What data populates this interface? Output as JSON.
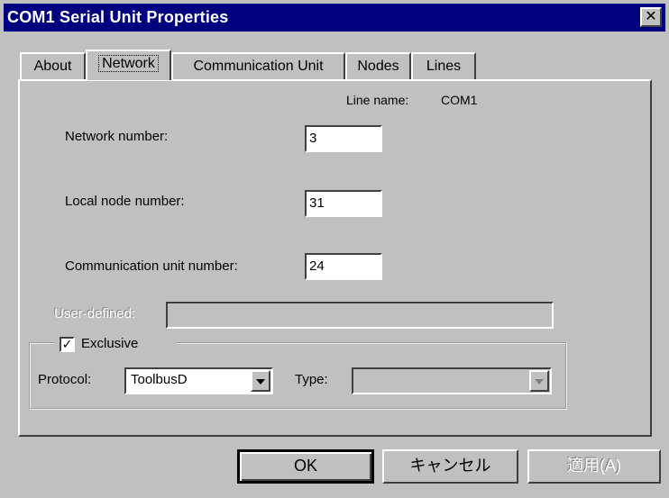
{
  "window": {
    "title": "COM1 Serial Unit Properties",
    "close_glyph": "✕"
  },
  "tabs": [
    {
      "label": "About"
    },
    {
      "label": "Network"
    },
    {
      "label": "Communication Unit"
    },
    {
      "label": "Nodes"
    },
    {
      "label": "Lines"
    }
  ],
  "network": {
    "line_name_label": "Line name:",
    "line_name_value": "COM1",
    "network_number_label": "Network number:",
    "network_number_value": "3",
    "local_node_label": "Local node number:",
    "local_node_value": "31",
    "comm_unit_label": "Communication unit number:",
    "comm_unit_value": "24",
    "user_defined_label": "User-defined:",
    "user_defined_value": "",
    "exclusive_label": "Exclusive",
    "exclusive_checked": "✓",
    "protocol_label": "Protocol:",
    "protocol_value": "ToolbusD",
    "type_label": "Type:",
    "type_value": ""
  },
  "buttons": {
    "ok": "OK",
    "cancel": "キャンセル",
    "apply": "適用(A)"
  },
  "colors": {
    "titlebar": "#000080",
    "face": "#c0c0c0"
  }
}
